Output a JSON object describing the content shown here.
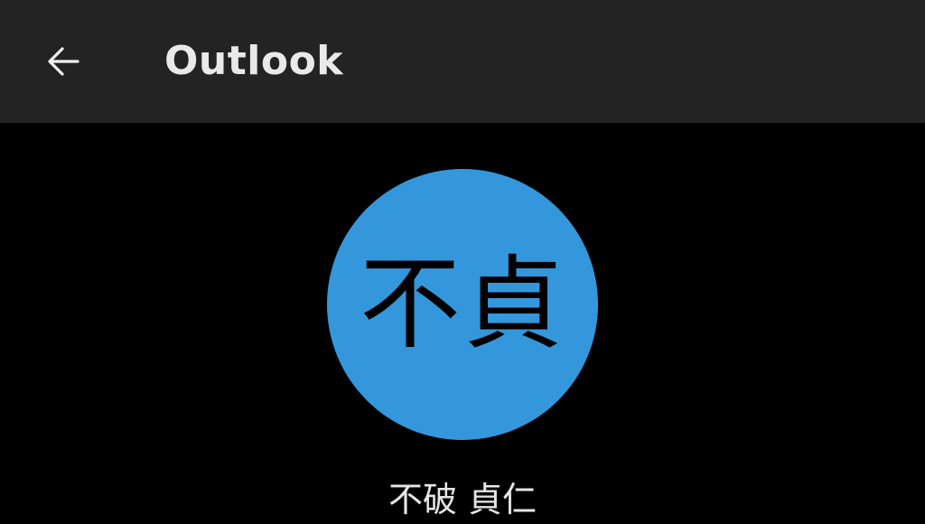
{
  "header": {
    "back_icon": "arrow-left-icon",
    "title": "Outlook",
    "background": "#232323",
    "title_color": "#e9e9e9"
  },
  "profile": {
    "avatar_initials": "不貞",
    "avatar_color": "#3497db",
    "name": "不破 貞仁"
  },
  "colors": {
    "page_background": "#000000",
    "name_text": "#e6e6e6"
  }
}
